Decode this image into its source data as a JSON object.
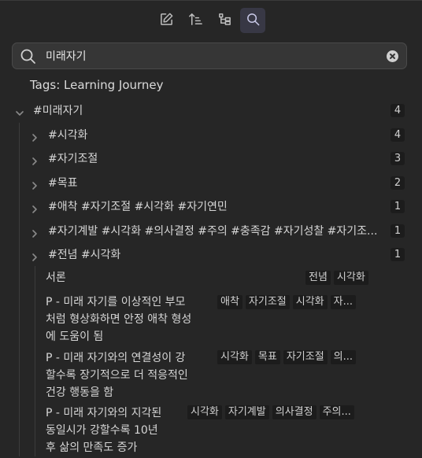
{
  "toolbar": {
    "buttons": [
      {
        "name": "new-note",
        "icon": "edit-icon"
      },
      {
        "name": "sort",
        "icon": "sort-icon"
      },
      {
        "name": "hierarchy",
        "icon": "tree-icon"
      },
      {
        "name": "search",
        "icon": "search-icon",
        "active": true
      }
    ]
  },
  "search": {
    "value": "미래자기"
  },
  "tags_label": "Tags: Learning Journey",
  "root": {
    "label": "#미래자기",
    "count": "4"
  },
  "children": [
    {
      "label": "#시각화",
      "count": "4"
    },
    {
      "label": "#자기조절",
      "count": "3"
    },
    {
      "label": "#목표",
      "count": "2"
    },
    {
      "label": "#애착 #자기조절 #시각화 #자기연민",
      "count": "1"
    },
    {
      "label": "#자기계발 #시각화 #의사결정 #주의 #충족감 #자기성찰 #자기조...",
      "count": "1"
    },
    {
      "label": "#전념 #시각화",
      "count": "1"
    }
  ],
  "files": [
    {
      "title": "서론",
      "tags": [
        "전념",
        "시각화"
      ]
    },
    {
      "title_lines": [
        "P - 미래 자기를 이상적인 부모",
        "처럼 형상화하면 안정 애착 형성",
        "에 도움이 됨"
      ],
      "tags": [
        "애착",
        "자기조절",
        "시각화",
        "자..."
      ]
    },
    {
      "title_lines": [
        "P - 미래 자기와의 연결성이 강",
        "할수록 장기적으로 더 적응적인",
        "건강 행동을 함"
      ],
      "tags": [
        "시각화",
        "목표",
        "자기조절",
        "의..."
      ]
    },
    {
      "title_lines": [
        "P - 미래 자기와의 지각된",
        "동일시가 강할수록 10년",
        "후 삶의 만족도 증가"
      ],
      "tags": [
        "시각화",
        "자기계발",
        "의사결정",
        "주의..."
      ]
    }
  ],
  "colors": {
    "background": "#262626",
    "search_bg": "#363636",
    "badge_bg": "#1c1c1c",
    "active_btn": "#383845"
  }
}
